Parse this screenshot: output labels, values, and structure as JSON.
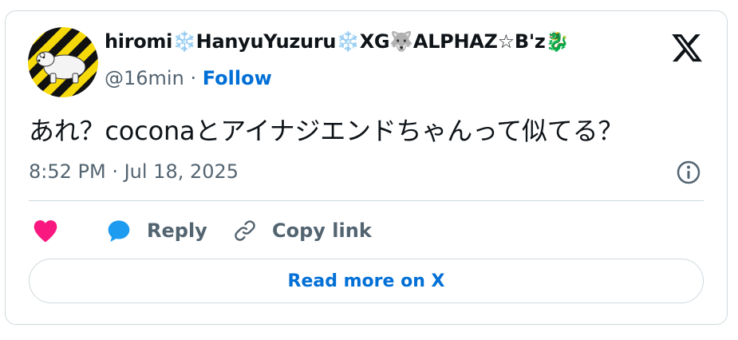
{
  "tweet": {
    "author": {
      "display_name": "hiromi❄️HanyuYuzuru❄️XG🐺ALPHAZ☆B'z🐉",
      "handle": "@16min",
      "separator": "·",
      "follow_label": "Follow"
    },
    "text": "あれ？coconaとアイナジエンドちゃんって似てる？",
    "timestamp": "8:52 PM · Jul 18, 2025",
    "actions": {
      "reply_label": "Reply",
      "copy_link_label": "Copy link"
    },
    "read_more_label": "Read more on X"
  },
  "icons": {
    "brand": "x-logo-icon",
    "info": "info-icon",
    "like": "heart-icon",
    "reply": "speech-bubble-icon",
    "copy": "link-icon"
  },
  "colors": {
    "link_blue": "#006fd6",
    "heart": "#f91880",
    "reply_bubble": "#1d9bf0",
    "secondary_text": "#536471",
    "primary_text": "#0f1419",
    "border": "#cfd9de"
  }
}
